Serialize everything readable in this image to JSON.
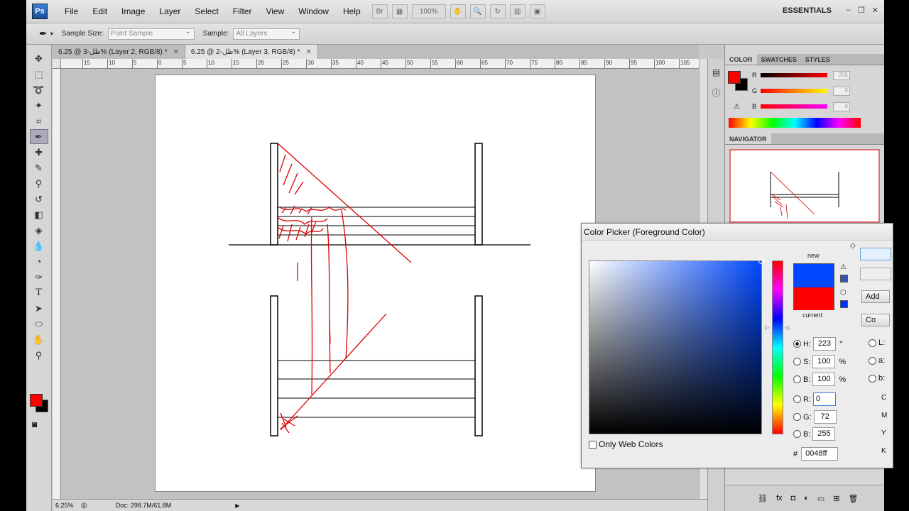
{
  "menubar": {
    "logo": "Ps",
    "items": [
      "File",
      "Edit",
      "Image",
      "Layer",
      "Select",
      "Filter",
      "View",
      "Window",
      "Help"
    ],
    "zoom_display": "100%",
    "workspace": "ESSENTIALS"
  },
  "options": {
    "sample_size_label": "Sample Size:",
    "sample_size_value": "Point Sample",
    "sample_label": "Sample:",
    "sample_value": "All Layers"
  },
  "doc_tabs": [
    {
      "label": "6.25 @ 3-ظل% (Layer 2, RGB/8) *",
      "active": false
    },
    {
      "label": "6.25 @ 2-ظل% (Layer 3, RGB/8) *",
      "active": true
    }
  ],
  "ruler": {
    "labels": [
      "15",
      "10",
      "5",
      "0",
      "5",
      "10",
      "15",
      "20",
      "25",
      "30",
      "35",
      "40",
      "45",
      "50",
      "55",
      "60",
      "65",
      "70",
      "75",
      "80",
      "85",
      "90",
      "95",
      "100",
      "105"
    ]
  },
  "status": {
    "zoom": "6.25%",
    "doc": "Doc: 298.7M/61.8M"
  },
  "color_panel": {
    "tabs": [
      "COLOR",
      "SWATCHES",
      "STYLES"
    ],
    "channels": [
      {
        "name": "R",
        "value": "255",
        "color": "#ff0000"
      },
      {
        "name": "G",
        "value": "0",
        "color": "#ffff00"
      },
      {
        "name": "B",
        "value": "0",
        "color": "#ff00ff"
      }
    ],
    "foreground": "#ff0000",
    "background": "#000000"
  },
  "navigator": {
    "title": "NAVIGATOR"
  },
  "picker": {
    "title": "Color Picker (Foreground Color)",
    "new_label": "new",
    "current_label": "current",
    "new_color": "#0048ff",
    "current_color": "#ff0000",
    "hsb": [
      {
        "name": "H:",
        "value": "223",
        "unit": "°",
        "selected": true
      },
      {
        "name": "S:",
        "value": "100",
        "unit": "%",
        "selected": false
      },
      {
        "name": "B:",
        "value": "100",
        "unit": "%",
        "selected": false
      }
    ],
    "rgb": [
      {
        "name": "R:",
        "value": "0"
      },
      {
        "name": "G:",
        "value": "72"
      },
      {
        "name": "B:",
        "value": "255"
      }
    ],
    "hex_label": "#",
    "hex": "0048ff",
    "web_only_label": "Only Web Colors",
    "add_button": "Add",
    "color_button": "Co",
    "lab": [
      "L:",
      "a:",
      "b:"
    ],
    "cmyk": [
      "C",
      "M",
      "Y",
      "K"
    ]
  }
}
